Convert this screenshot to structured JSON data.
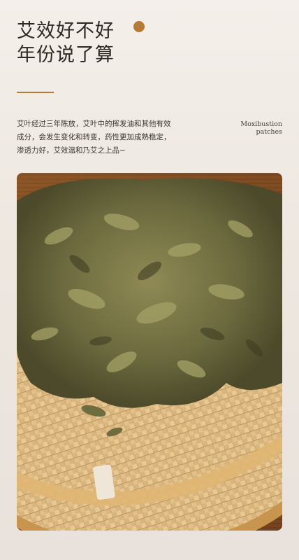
{
  "headline": {
    "line1": "艾效好不好",
    "line2": "年份说了算"
  },
  "description": {
    "line1": "艾叶经过三年陈放，艾叶中的挥发油和其他有效",
    "line2": "成分，会发生变化和转变，药性更加成熟稳定，",
    "line3": "渗透力好，艾效温和乃艾之上品~"
  },
  "english_tag": {
    "line1": "Moxibustion",
    "line2": "patches"
  },
  "colors": {
    "accent": "#b57a36",
    "background": "#f1ebe5",
    "text": "#2e2924"
  }
}
